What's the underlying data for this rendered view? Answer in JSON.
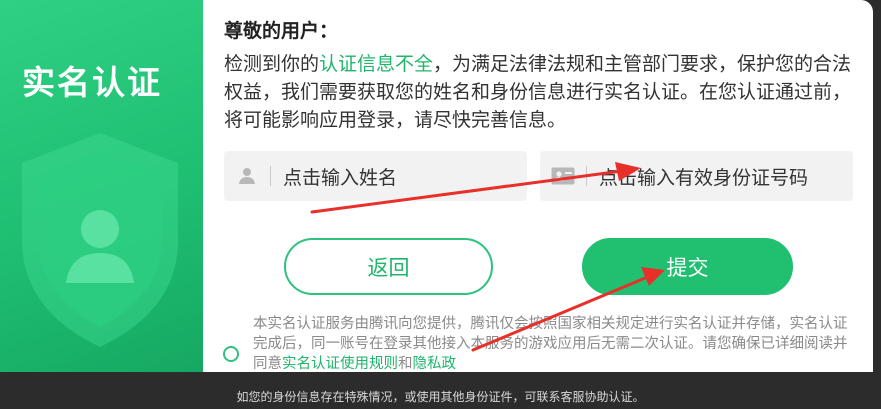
{
  "panel": {
    "title": "实名认证"
  },
  "content": {
    "greeting": "尊敬的用户：",
    "notice_before": "检测到你的",
    "notice_highlight": "认证信息不全",
    "notice_after": "，为满足法律法规和主管部门要求，保护您的合法权益，我们需要获取您的姓名和身份信息进行实名认证。在您认证通过前，将可能影响应用登录，请尽快完善信息。"
  },
  "form": {
    "name_placeholder": "点击输入姓名",
    "id_placeholder": "点击输入有效身份证号码"
  },
  "buttons": {
    "back": "返回",
    "submit": "提交"
  },
  "agreement": {
    "text": "本实名认证服务由腾讯向您提供，腾讯仅会按照国家相关规定进行实名认证并存储，实名认证完成后，同一账号在登录其他接入本服务的游戏应用后无需二次认证。请您确保已详细阅读并同意",
    "link_rules": "实名认证使用规则",
    "conjunction": "和",
    "link_privacy": "隐私政"
  },
  "footer": {
    "note": "如您的身份信息存在特殊情况，或使用其他身份证件，可联系客服协助认证。"
  },
  "colors": {
    "brand": "#21c071",
    "annotation": "#e8302a",
    "backdrop": "#2c2c2c"
  },
  "icons": {
    "shield": "shield-user-icon",
    "name": "person-icon",
    "id": "id-card-icon"
  }
}
